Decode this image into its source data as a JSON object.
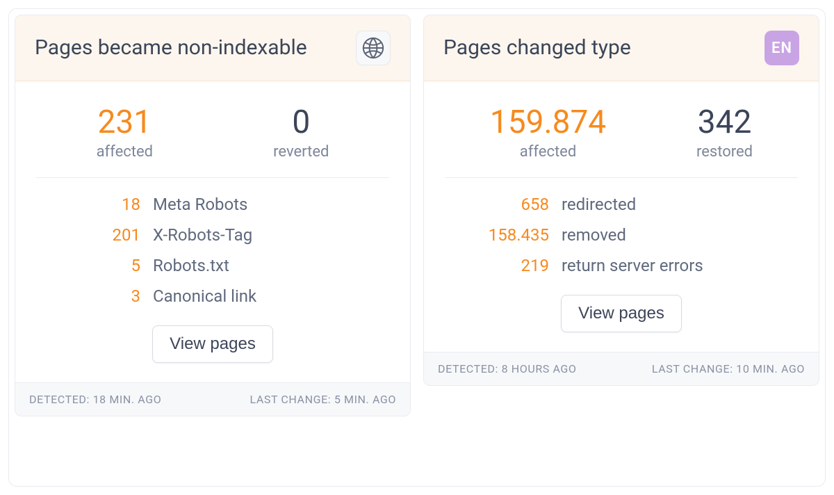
{
  "cards": [
    {
      "title": "Pages became non-indexable",
      "badge_type": "globe",
      "badge_text": "",
      "stat_a_value": "231",
      "stat_a_label": "affected",
      "stat_b_value": "0",
      "stat_b_label": "reverted",
      "breakdown": [
        {
          "num": "18",
          "label": "Meta Robots"
        },
        {
          "num": "201",
          "label": "X-Robots-Tag"
        },
        {
          "num": "5",
          "label": "Robots.txt"
        },
        {
          "num": "3",
          "label": "Canonical link"
        }
      ],
      "button_label": "View pages",
      "footer_detected_label": "Detected:",
      "footer_detected_value": "18 min. ago",
      "footer_change_label": "Last change:",
      "footer_change_value": "5 min. ago"
    },
    {
      "title": "Pages changed type",
      "badge_type": "lang",
      "badge_text": "EN",
      "stat_a_value": "159.874",
      "stat_a_label": "affected",
      "stat_b_value": "342",
      "stat_b_label": "restored",
      "breakdown": [
        {
          "num": "658",
          "label": "redirected"
        },
        {
          "num": "158.435",
          "label": "removed"
        },
        {
          "num": "219",
          "label": "return server errors"
        }
      ],
      "button_label": "View pages",
      "footer_detected_label": "Detected:",
      "footer_detected_value": "8 hours ago",
      "footer_change_label": "Last change:",
      "footer_change_value": "10 min. ago"
    }
  ]
}
